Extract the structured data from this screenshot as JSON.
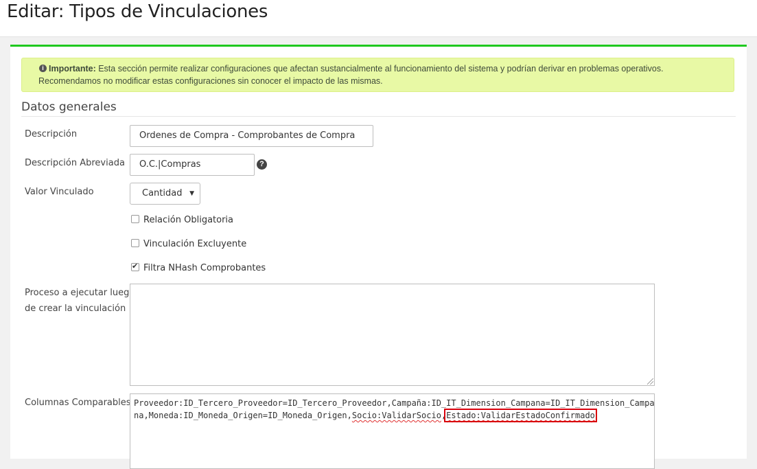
{
  "header": {
    "title": "Editar: Tipos de Vinculaciones"
  },
  "alert": {
    "icon": "info-circle-icon",
    "strong": "Importante:",
    "line1": " Esta sección permite realizar configuraciones que afectan sustancialmente al funcionamiento del sistema y podrían derivar en problemas operativos.",
    "line2": "Recomendamos no modificar estas configuraciones sin conocer el impacto de las mismas."
  },
  "section": {
    "title": "Datos generales"
  },
  "form": {
    "descripcion": {
      "label": "Descripción",
      "value": "Ordenes de Compra - Comprobantes de Compra"
    },
    "descripcion_abreviada": {
      "label": "Descripción Abreviada",
      "value": "O.C.|Compras",
      "help_icon": "question-circle-icon"
    },
    "valor_vinculado": {
      "label": "Valor Vinculado",
      "selected": "Cantidad"
    },
    "checkboxes": [
      {
        "label": "Relación Obligatoria",
        "checked": false
      },
      {
        "label": "Vinculación Excluyente",
        "checked": false
      },
      {
        "label": "Filtra NHash Comprobantes",
        "checked": true
      }
    ],
    "proceso": {
      "label_line1": "Proceso a ejecutar luego",
      "label_line2": "de crear la vinculación",
      "value": ""
    },
    "columnas": {
      "label": "Columnas Comparables",
      "text_main": "Proveedor:ID_Tercero_Proveedor=ID_Tercero_Proveedor,Campaña:ID_IT_Dimension_Campana=ID_IT_Dimension_Campana,Moneda:ID_Moneda_Origen=ID_Moneda_Origen,",
      "text_socio": "Socio:ValidarSocio",
      "text_sep": ",",
      "text_estado": "Estado:ValidarEstadoConfirmado"
    }
  },
  "colors": {
    "accent": "#1fc91f",
    "alert_bg": "#e8f9a5",
    "highlight": "#d9000b"
  }
}
